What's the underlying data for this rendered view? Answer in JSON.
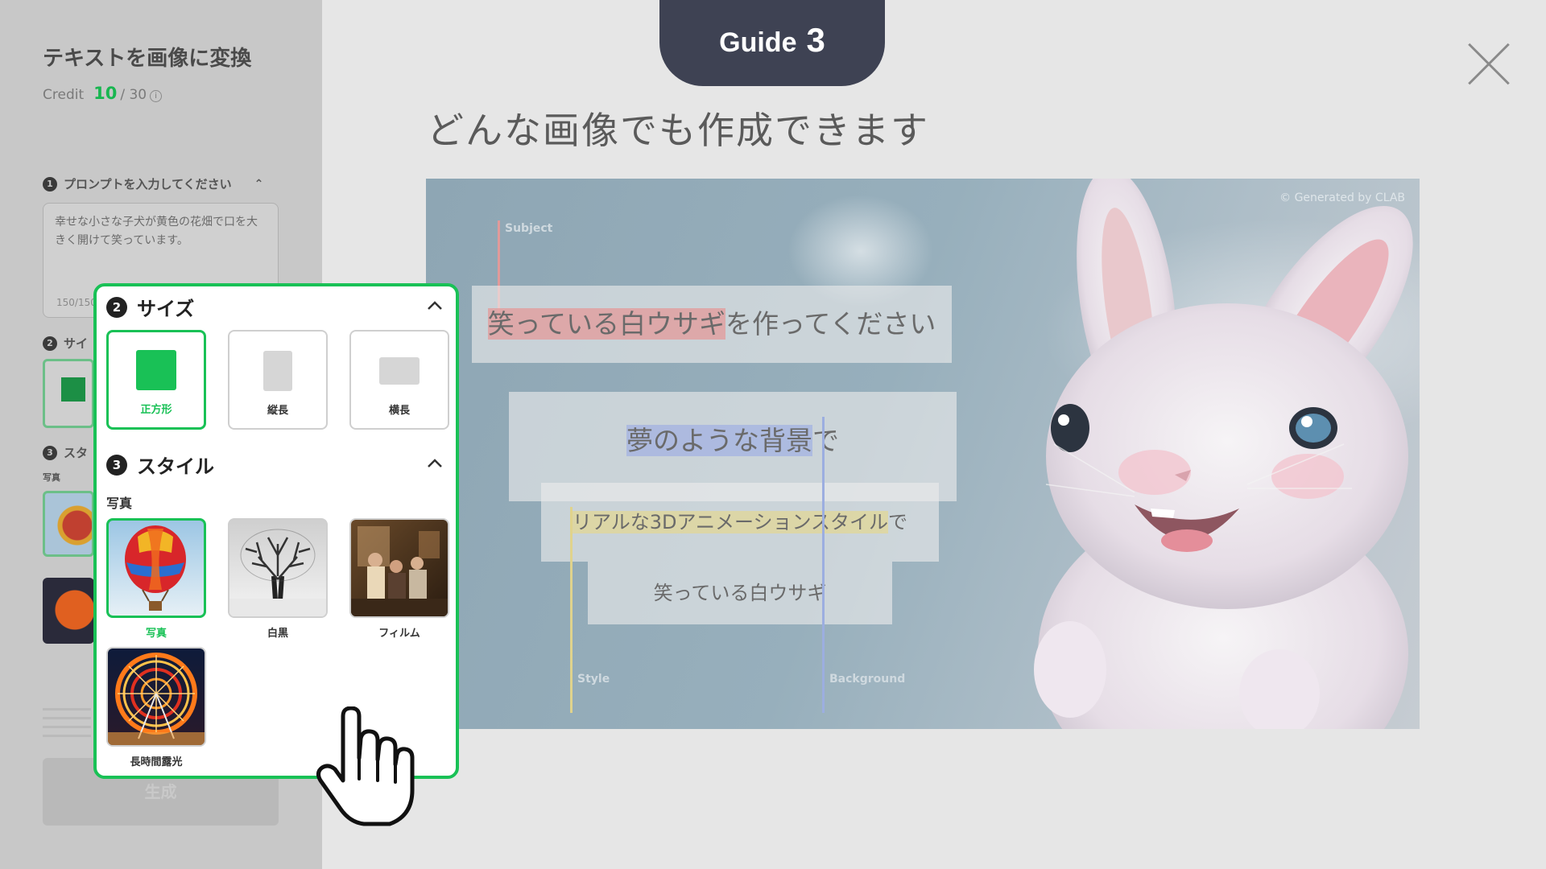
{
  "sidebar": {
    "title": "テキストを画像に変換",
    "credit_label": "Credit",
    "credit_current": "10",
    "credit_total": "/ 30",
    "prompt_step_num": "1",
    "prompt_step_label": "プロンプトを入力してください",
    "prompt_value": "幸せな小さな子犬が黄色の花畑で口を大きく開けて笑っています。",
    "char_count": "150/150",
    "size_step_num": "2",
    "size_step_label_partial": "サイ",
    "style_step_num": "3",
    "style_step_label_partial": "スタ",
    "style_category_partial": "写真",
    "generate_label": "生成"
  },
  "guide": {
    "word": "Guide",
    "number": "3",
    "headline": "どんな画像でも作成できます"
  },
  "example": {
    "copyright": "© Generated by CLAB",
    "subject_label": "Subject",
    "style_label": "Style",
    "background_label": "Background",
    "line1_highlight": "笑っている白ウサギ",
    "line1_rest": "を作ってください",
    "line2_highlight": "夢のような背景",
    "line2_rest": "で",
    "line3_highlight": "リアルな3Dアニメーションスタイル",
    "line3_rest": "で",
    "line4": "笑っている白ウサギ"
  },
  "popup": {
    "size_num": "2",
    "size_title": "サイズ",
    "size_options": [
      {
        "label": "正方形",
        "selected": true
      },
      {
        "label": "縦長",
        "selected": false
      },
      {
        "label": "横長",
        "selected": false
      }
    ],
    "style_num": "3",
    "style_title": "スタイル",
    "category": "写真",
    "style_options": [
      {
        "label": "写真",
        "icon": "hot-air-balloon",
        "selected": true
      },
      {
        "label": "白黒",
        "icon": "bare-tree",
        "selected": false
      },
      {
        "label": "フィルム",
        "icon": "family-room-photo",
        "selected": false
      },
      {
        "label": "長時間露光",
        "icon": "ferris-wheel",
        "selected": false
      }
    ]
  },
  "colors": {
    "accent_green": "#19c156",
    "guide_tab": "#3e4253",
    "highlight_subject": "#e69696",
    "highlight_background": "#a5b4e1",
    "highlight_style": "#e1d796"
  }
}
